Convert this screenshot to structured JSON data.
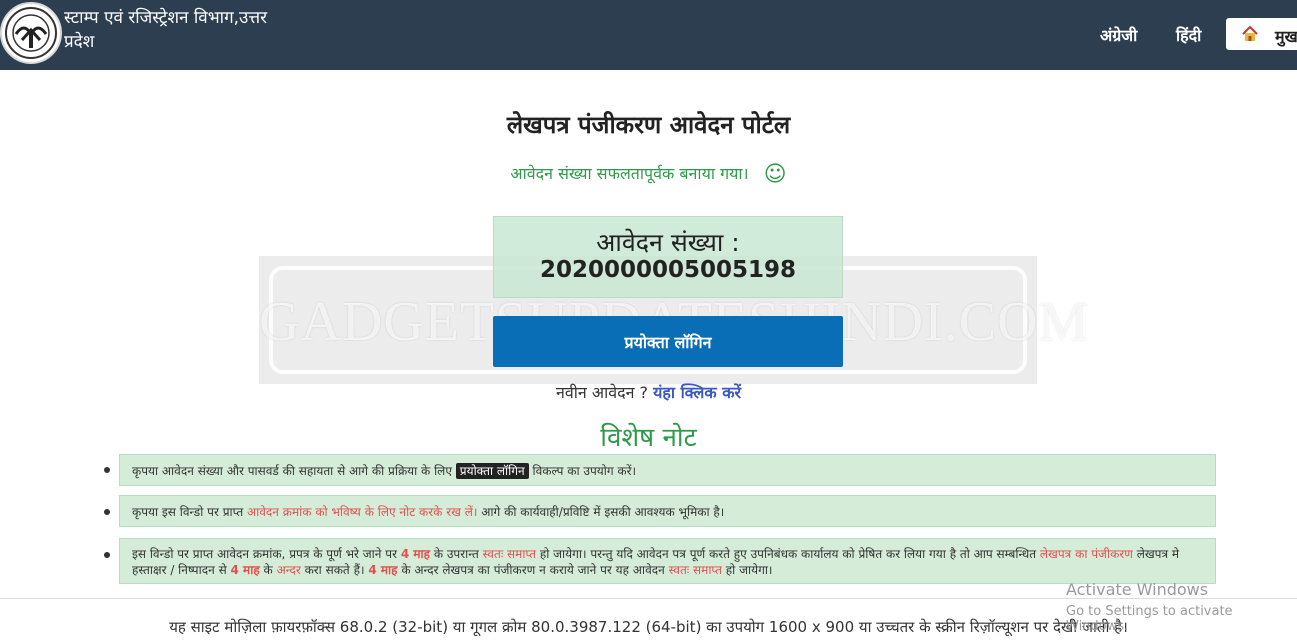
{
  "header": {
    "site_title": "स्टाम्प एवं रजिस्ट्रेशन विभाग,उत्तर प्रदेश",
    "nav_english": "अंग्रेजी",
    "nav_hindi": "हिंदी",
    "home_label": "मुख"
  },
  "main": {
    "portal_title": "लेखपत्र पंजीकरण आवेदन पोर्टल",
    "success_message": "आवेदन संख्या सफलतापूर्वक बनाया गया।",
    "success_emoji": "☺",
    "application_label": "आवेदन संख्या :",
    "application_number": "2020000005005198",
    "login_button": "प्रयोक्ता लॉगिन",
    "new_application_prefix": "नवीन आवेदन ?",
    "new_application_link": "यंहा क्लिक करें",
    "note_heading": "विशेष नोट"
  },
  "notes": {
    "n1_before": "कृपया आवेदन संख्या और पासवर्ड की सहायता से आगे की प्रक्रिया के लिए",
    "n1_badge": "प्रयोक्ता लॉगिन",
    "n1_after": "विकल्प का उपयोग करें।",
    "n2_before": "कृपया इस विन्डो पर प्राप्त",
    "n2_red": "आवेदन क्रमांक को भविष्य के लिए नोट करके रख लें।",
    "n2_after": "आगे की कार्यवाही/प्रविष्टि में इसकी आवश्यक भूमिका है।",
    "n3_a": "इस विन्डो पर प्राप्त आवेदन क्रमांक, प्रपत्र के पूर्ण भरे जाने पर",
    "n3_b": "4 माह",
    "n3_c": "के उपरान्त",
    "n3_d": "स्वतः समाप्त",
    "n3_e": "हो जायेगा। परन्तु यदि आवेदन पत्र पूर्ण करते हुए उपनिबंधक कार्यालय को प्रेषित कर लिया गया है तो आप सम्बन्धित",
    "n3_f": "लेखपत्र का पंजीकरण",
    "n3_g": "लेखपत्र मे हस्ताक्षर / निष्पादन से",
    "n3_h": "4 माह",
    "n3_i": "के",
    "n3_j": "अन्दर",
    "n3_k": "करा सकते हैं।",
    "n3_l": "4 माह",
    "n3_m": "के अन्दर लेखपत्र का पंजीकरण न कराये जाने पर यह आवेदन",
    "n3_n": "स्वतः समाप्त",
    "n3_o": "हो जायेगा।"
  },
  "watermark": "GADGETSUPDATESHINDI.COM",
  "footer": "यह साइट मोज़िला फ़ायरफ़ॉक्स 68.0.2 (32-bit) या गूगल क्रोम 80.0.3987.122 (64-bit) का उपयोग 1600 x 900 या उच्चतर के स्क्रीन रिज़ॉल्यूशन पर देखी जाती है।",
  "os_overlay": {
    "title": "Activate Windows",
    "subtitle": "Go to Settings to activate Windows."
  },
  "colors": {
    "header_bg": "#2c3e50",
    "success_green": "#2e9a4a",
    "login_blue": "#0a6eb7",
    "link_blue": "#3b58c4",
    "note_bg": "#d5edd8",
    "note_red": "#e05050"
  },
  "icons": {
    "logo": "up-emblem-icon",
    "home": "home-icon",
    "smile": "smiley-icon"
  }
}
